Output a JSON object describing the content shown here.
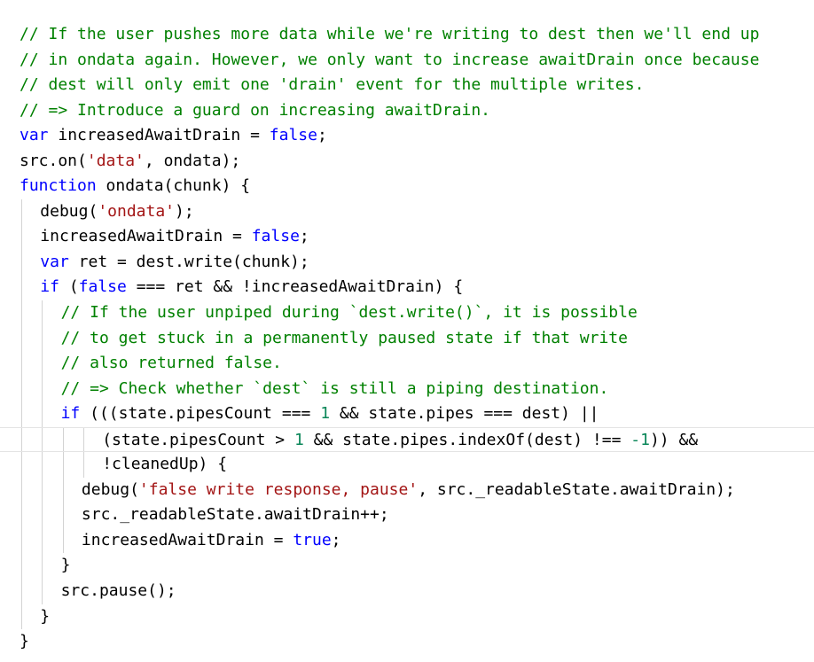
{
  "editor": {
    "colors": {
      "comment": "#008000",
      "keyword": "#0000ff",
      "string": "#a31515",
      "number": "#098658",
      "plain": "#000000",
      "indent_guide": "#d3d3d3",
      "background": "#ffffff"
    },
    "lines": [
      {
        "indent": 0,
        "tokens": [
          [
            "comment",
            "// If the user pushes more data while we're writing to dest then we'll end up"
          ]
        ]
      },
      {
        "indent": 0,
        "tokens": [
          [
            "comment",
            "// in ondata again. However, we only want to increase awaitDrain once because"
          ]
        ]
      },
      {
        "indent": 0,
        "tokens": [
          [
            "comment",
            "// dest will only emit one 'drain' event for the multiple writes."
          ]
        ]
      },
      {
        "indent": 0,
        "tokens": [
          [
            "comment",
            "// => Introduce a guard on increasing awaitDrain."
          ]
        ]
      },
      {
        "indent": 0,
        "tokens": [
          [
            "keyword",
            "var"
          ],
          [
            "plain",
            " increasedAwaitDrain = "
          ],
          [
            "keyword",
            "false"
          ],
          [
            "plain",
            ";"
          ]
        ]
      },
      {
        "indent": 0,
        "tokens": [
          [
            "plain",
            "src.on("
          ],
          [
            "string",
            "'data'"
          ],
          [
            "plain",
            ", ondata);"
          ]
        ]
      },
      {
        "indent": 0,
        "tokens": [
          [
            "keyword",
            "function"
          ],
          [
            "plain",
            " ondata(chunk) {"
          ]
        ]
      },
      {
        "indent": 1,
        "tokens": [
          [
            "plain",
            "debug("
          ],
          [
            "string",
            "'ondata'"
          ],
          [
            "plain",
            ");"
          ]
        ]
      },
      {
        "indent": 1,
        "tokens": [
          [
            "plain",
            "increasedAwaitDrain = "
          ],
          [
            "keyword",
            "false"
          ],
          [
            "plain",
            ";"
          ]
        ]
      },
      {
        "indent": 1,
        "tokens": [
          [
            "keyword",
            "var"
          ],
          [
            "plain",
            " ret = dest.write(chunk);"
          ]
        ]
      },
      {
        "indent": 1,
        "tokens": [
          [
            "keyword",
            "if"
          ],
          [
            "plain",
            " ("
          ],
          [
            "keyword",
            "false"
          ],
          [
            "plain",
            " === ret && !increasedAwaitDrain) {"
          ]
        ]
      },
      {
        "indent": 2,
        "tokens": [
          [
            "comment",
            "// If the user unpiped during `dest.write()`, it is possible"
          ]
        ]
      },
      {
        "indent": 2,
        "tokens": [
          [
            "comment",
            "// to get stuck in a permanently paused state if that write"
          ]
        ]
      },
      {
        "indent": 2,
        "tokens": [
          [
            "comment",
            "// also returned false."
          ]
        ]
      },
      {
        "indent": 2,
        "tokens": [
          [
            "comment",
            "// => Check whether `dest` is still a piping destination."
          ]
        ]
      },
      {
        "indent": 2,
        "tokens": [
          [
            "keyword",
            "if"
          ],
          [
            "plain",
            " (((state.pipesCount === "
          ],
          [
            "number",
            "1"
          ],
          [
            "plain",
            " && state.pipes === dest) ||"
          ]
        ]
      },
      {
        "indent": 4,
        "current": true,
        "tokens": [
          [
            "plain",
            "(state.pipesCount > "
          ],
          [
            "number",
            "1"
          ],
          [
            "plain",
            " && state.pipes.indexOf(dest) !== "
          ],
          [
            "number",
            "-1"
          ],
          [
            "plain",
            ")) &&"
          ]
        ]
      },
      {
        "indent": 4,
        "tokens": [
          [
            "plain",
            "!cleanedUp) {"
          ]
        ]
      },
      {
        "indent": 3,
        "tokens": [
          [
            "plain",
            "debug("
          ],
          [
            "string",
            "'false write response, pause'"
          ],
          [
            "plain",
            ", src._readableState.awaitDrain);"
          ]
        ]
      },
      {
        "indent": 3,
        "tokens": [
          [
            "plain",
            "src._readableState.awaitDrain++;"
          ]
        ]
      },
      {
        "indent": 3,
        "tokens": [
          [
            "plain",
            "increasedAwaitDrain = "
          ],
          [
            "keyword",
            "true"
          ],
          [
            "plain",
            ";"
          ]
        ]
      },
      {
        "indent": 2,
        "tokens": [
          [
            "plain",
            "}"
          ]
        ]
      },
      {
        "indent": 2,
        "tokens": [
          [
            "plain",
            "src.pause();"
          ]
        ]
      },
      {
        "indent": 1,
        "tokens": [
          [
            "plain",
            "}"
          ]
        ]
      },
      {
        "indent": 0,
        "tokens": [
          [
            "plain",
            "}"
          ]
        ]
      }
    ]
  }
}
